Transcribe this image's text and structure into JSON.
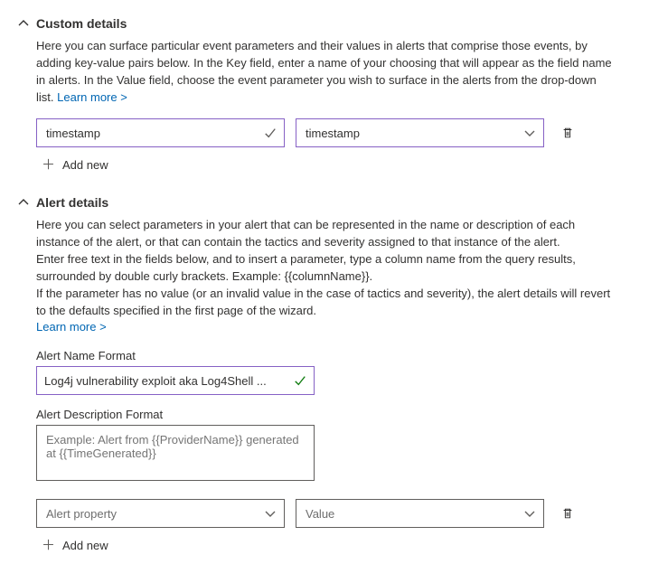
{
  "sections": {
    "custom": {
      "title": "Custom details",
      "description": "Here you can surface particular event parameters and their values in alerts that comprise those events, by adding key-value pairs below. In the Key field, enter a name of your choosing that will appear as the field name in alerts. In the Value field, choose the event parameter you wish to surface in the alerts from the drop-down list. ",
      "learn_more": "Learn more >",
      "row": {
        "key_value": "timestamp",
        "value_value": "timestamp"
      },
      "add_new": "Add new"
    },
    "alert": {
      "title": "Alert details",
      "desc1": "Here you can select parameters in your alert that can be represented in the name or description of each instance of the alert, or that can contain the tactics and severity assigned to that instance of the alert.",
      "desc2": "Enter free text in the fields below, and to insert a parameter, type a column name from the query results, surrounded by double curly brackets. Example: {{columnName}}.",
      "desc3": "If the parameter has no value (or an invalid value in the case of tactics and severity), the alert details will revert to the defaults specified in the first page of the wizard.",
      "learn_more": "Learn more >",
      "name_label": "Alert Name Format",
      "name_value": "Log4j vulnerability exploit aka Log4Shell ...",
      "desc_label": "Alert Description Format",
      "desc_placeholder": "Example: Alert from {{ProviderName}} generated at {{TimeGenerated}}",
      "property_placeholder": "Alert property",
      "value_placeholder": "Value",
      "add_new": "Add new"
    }
  }
}
